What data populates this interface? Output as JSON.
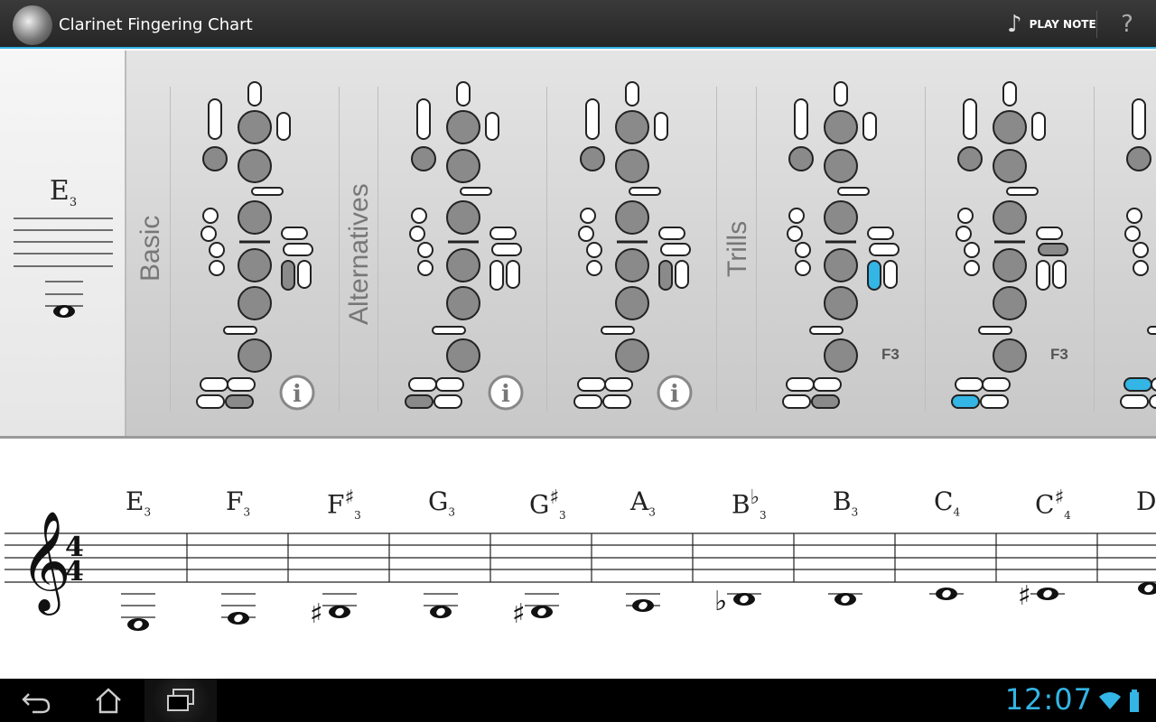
{
  "app": {
    "title": "Clarinet Fingering Chart"
  },
  "toolbar": {
    "play_note_label": "PLAY NOTE",
    "help_label": "?",
    "music_icon": "music-note-icon"
  },
  "current_note": {
    "name": "E",
    "octave": "3"
  },
  "categories": [
    {
      "label": "Basic"
    },
    {
      "label": "Alternatives"
    },
    {
      "label": "Trills"
    }
  ],
  "fingerings": [
    {
      "category": "Basic",
      "info_label": "i",
      "trill_label": ""
    },
    {
      "category": "Alternatives",
      "info_label": "i",
      "trill_label": ""
    },
    {
      "category": "Alternatives",
      "info_label": "i",
      "trill_label": ""
    },
    {
      "category": "Trills",
      "info_label": "",
      "trill_label": "F3"
    },
    {
      "category": "Trills",
      "info_label": "",
      "trill_label": "F3"
    }
  ],
  "notes": [
    {
      "name": "E",
      "accidental": "",
      "octave": "3"
    },
    {
      "name": "F",
      "accidental": "",
      "octave": "3"
    },
    {
      "name": "F",
      "accidental": "♯",
      "octave": "3"
    },
    {
      "name": "G",
      "accidental": "",
      "octave": "3"
    },
    {
      "name": "G",
      "accidental": "♯",
      "octave": "3"
    },
    {
      "name": "A",
      "accidental": "",
      "octave": "3"
    },
    {
      "name": "B",
      "accidental": "♭",
      "octave": "3"
    },
    {
      "name": "B",
      "accidental": "",
      "octave": "3"
    },
    {
      "name": "C",
      "accidental": "",
      "octave": "4"
    },
    {
      "name": "C",
      "accidental": "♯",
      "octave": "4"
    },
    {
      "name": "D",
      "accidental": "",
      "octave": ""
    }
  ],
  "time_signature": {
    "top": "4",
    "bottom": "4"
  },
  "status": {
    "time": "12:07"
  },
  "colors": {
    "accent": "#33b5e5",
    "key_closed": "#8a8a8a",
    "key_trill": "#33b5e5"
  }
}
